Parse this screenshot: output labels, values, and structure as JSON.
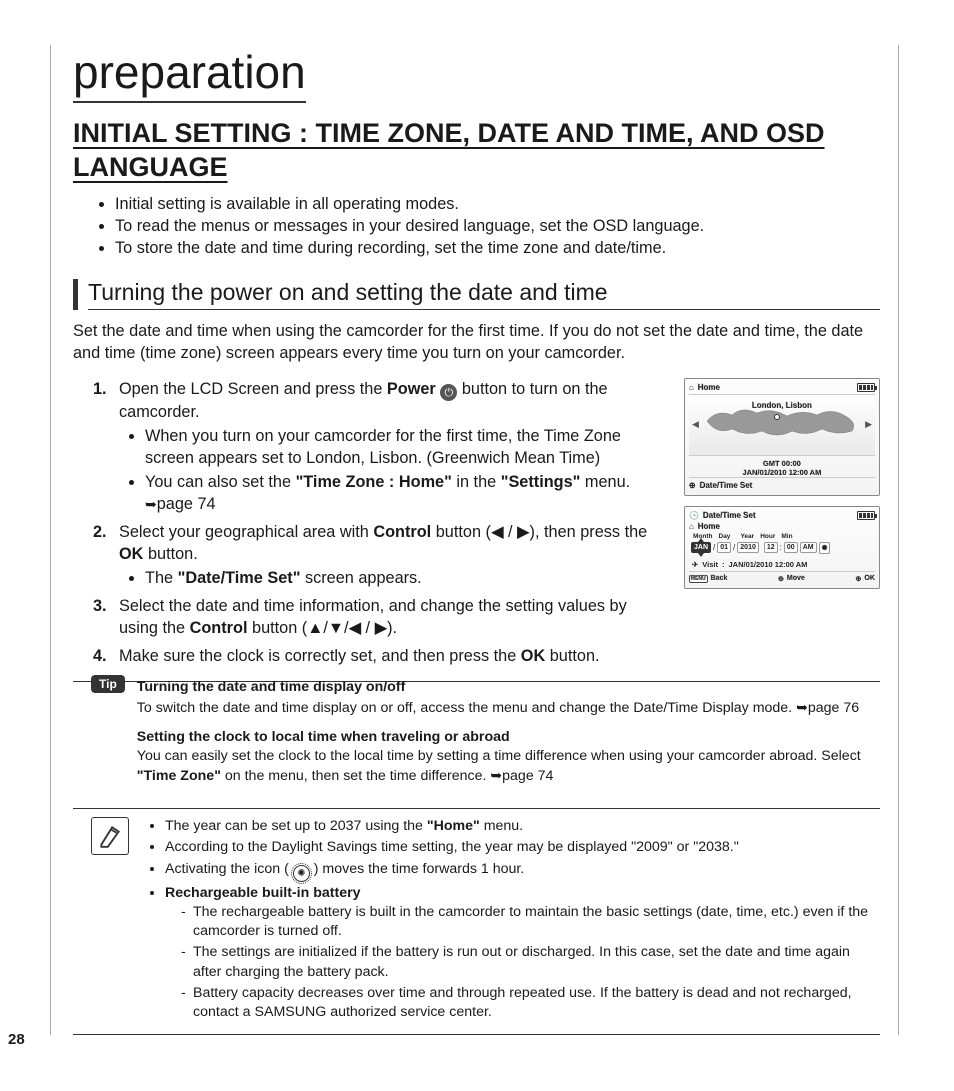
{
  "pageNumber": "28",
  "chapterTitle": "preparation",
  "sectionHeading": "INITIAL SETTING : TIME ZONE, DATE AND TIME, AND OSD LANGUAGE",
  "topBullets": [
    "Initial setting is available in all operating modes.",
    "To read the menus or messages in your desired language, set the OSD language.",
    "To store the date and time during recording, set the time zone and date/time."
  ],
  "subHeading": "Turning the power on and setting the date and time",
  "intro": "Set the date and time when using the camcorder for the first time. If you do not set the date and time, the date and time (time zone) screen appears every time you turn on your camcorder.",
  "steps": {
    "s1a": "Open the LCD Screen and press the ",
    "s1b": "Power",
    "s1c": " button to turn on the camcorder.",
    "s1sub1": "When you turn on your camcorder for the first time, the Time Zone screen appears set to London, Lisbon. (Greenwich Mean Time)",
    "s1sub2a": "You can also set the ",
    "s1sub2b": "\"Time Zone : Home\"",
    "s1sub2c": " in the ",
    "s1sub2d": "\"Settings\"",
    "s1sub2e": " menu. ",
    "s1sub2f": "page 74",
    "s2a": "Select your geographical area with ",
    "s2b": "Control",
    "s2c": " button (◀ / ▶), then press the ",
    "s2d": "OK",
    "s2e": " button.",
    "s2sub1a": "The ",
    "s2sub1b": "\"Date/Time Set\"",
    "s2sub1c": " screen appears.",
    "s3a": "Select the date and time information, and change the setting values by using the ",
    "s3b": "Control",
    "s3c": " button (▲/▼/◀ / ▶).",
    "s4a": "Make sure the clock is correctly set, and then press the ",
    "s4b": "OK",
    "s4c": " button."
  },
  "lcd1": {
    "title": "Home",
    "city": "London, Lisbon",
    "gmt": "GMT 00:00",
    "date": "JAN/01/2010 12:00 AM",
    "foot": "Date/Time Set"
  },
  "lcd2": {
    "title": "Date/Time Set",
    "sub": "Home",
    "labels": {
      "month": "Month",
      "day": "Day",
      "year": "Year",
      "hour": "Hour",
      "min": "Min"
    },
    "vals": {
      "month": "JAN",
      "day": "01",
      "year": "2010",
      "hour": "12",
      "min": "00",
      "ampm": "AM"
    },
    "visitLabel": "Visit",
    "visitVal": "JAN/01/2010 12:00 AM",
    "back": "Back",
    "move": "Move",
    "ok": "OK",
    "menu": "MENU"
  },
  "tip": {
    "badge": "Tip",
    "p1title": "Turning the date and time display on/off",
    "p1": "To switch the date and time display on or off, access the menu and change the Date/Time Display mode. ",
    "p1ref": "page 76",
    "p2title": "Setting the clock to local time when traveling or abroad",
    "p2a": "You can easily set the clock to the local time by setting a time difference when using your camcorder abroad. Select ",
    "p2b": "\"Time Zone\"",
    "p2c": " on the menu, then set the time difference. ",
    "p2ref": "page 74"
  },
  "notes": {
    "n1a": "The year can be set up to 2037 using the ",
    "n1b": "\"Home\"",
    "n1c": " menu.",
    "n2": "According to the Daylight Savings time setting, the year may be displayed \"2009\" or \"2038.\"",
    "n3a": "Activating the icon (",
    "n3b": ") moves the time forwards 1 hour.",
    "n4": "Rechargeable built-in battery",
    "n4a": "The rechargeable battery is built in the camcorder to maintain the basic settings (date, time, etc.) even if the camcorder is turned off.",
    "n4b": "The settings are initialized if the battery is run out or discharged. In this case, set the date and time again after charging the battery pack.",
    "n4c": "Battery capacity decreases over time and through repeated use. If the battery is dead and not recharged, contact a SAMSUNG authorized service center."
  }
}
